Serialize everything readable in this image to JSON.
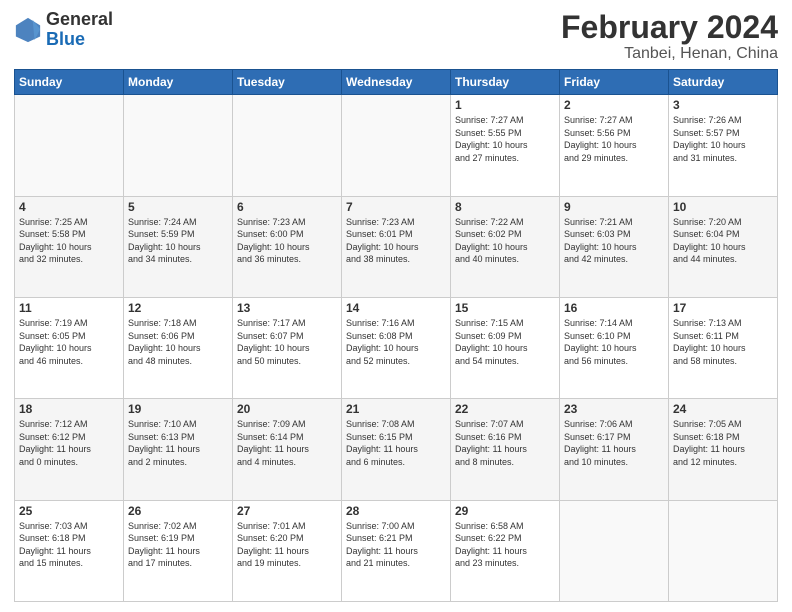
{
  "logo": {
    "general": "General",
    "blue": "Blue"
  },
  "header": {
    "title": "February 2024",
    "subtitle": "Tanbei, Henan, China"
  },
  "weekdays": [
    "Sunday",
    "Monday",
    "Tuesday",
    "Wednesday",
    "Thursday",
    "Friday",
    "Saturday"
  ],
  "weeks": [
    [
      {
        "day": "",
        "content": ""
      },
      {
        "day": "",
        "content": ""
      },
      {
        "day": "",
        "content": ""
      },
      {
        "day": "",
        "content": ""
      },
      {
        "day": "1",
        "content": "Sunrise: 7:27 AM\nSunset: 5:55 PM\nDaylight: 10 hours\nand 27 minutes."
      },
      {
        "day": "2",
        "content": "Sunrise: 7:27 AM\nSunset: 5:56 PM\nDaylight: 10 hours\nand 29 minutes."
      },
      {
        "day": "3",
        "content": "Sunrise: 7:26 AM\nSunset: 5:57 PM\nDaylight: 10 hours\nand 31 minutes."
      }
    ],
    [
      {
        "day": "4",
        "content": "Sunrise: 7:25 AM\nSunset: 5:58 PM\nDaylight: 10 hours\nand 32 minutes."
      },
      {
        "day": "5",
        "content": "Sunrise: 7:24 AM\nSunset: 5:59 PM\nDaylight: 10 hours\nand 34 minutes."
      },
      {
        "day": "6",
        "content": "Sunrise: 7:23 AM\nSunset: 6:00 PM\nDaylight: 10 hours\nand 36 minutes."
      },
      {
        "day": "7",
        "content": "Sunrise: 7:23 AM\nSunset: 6:01 PM\nDaylight: 10 hours\nand 38 minutes."
      },
      {
        "day": "8",
        "content": "Sunrise: 7:22 AM\nSunset: 6:02 PM\nDaylight: 10 hours\nand 40 minutes."
      },
      {
        "day": "9",
        "content": "Sunrise: 7:21 AM\nSunset: 6:03 PM\nDaylight: 10 hours\nand 42 minutes."
      },
      {
        "day": "10",
        "content": "Sunrise: 7:20 AM\nSunset: 6:04 PM\nDaylight: 10 hours\nand 44 minutes."
      }
    ],
    [
      {
        "day": "11",
        "content": "Sunrise: 7:19 AM\nSunset: 6:05 PM\nDaylight: 10 hours\nand 46 minutes."
      },
      {
        "day": "12",
        "content": "Sunrise: 7:18 AM\nSunset: 6:06 PM\nDaylight: 10 hours\nand 48 minutes."
      },
      {
        "day": "13",
        "content": "Sunrise: 7:17 AM\nSunset: 6:07 PM\nDaylight: 10 hours\nand 50 minutes."
      },
      {
        "day": "14",
        "content": "Sunrise: 7:16 AM\nSunset: 6:08 PM\nDaylight: 10 hours\nand 52 minutes."
      },
      {
        "day": "15",
        "content": "Sunrise: 7:15 AM\nSunset: 6:09 PM\nDaylight: 10 hours\nand 54 minutes."
      },
      {
        "day": "16",
        "content": "Sunrise: 7:14 AM\nSunset: 6:10 PM\nDaylight: 10 hours\nand 56 minutes."
      },
      {
        "day": "17",
        "content": "Sunrise: 7:13 AM\nSunset: 6:11 PM\nDaylight: 10 hours\nand 58 minutes."
      }
    ],
    [
      {
        "day": "18",
        "content": "Sunrise: 7:12 AM\nSunset: 6:12 PM\nDaylight: 11 hours\nand 0 minutes."
      },
      {
        "day": "19",
        "content": "Sunrise: 7:10 AM\nSunset: 6:13 PM\nDaylight: 11 hours\nand 2 minutes."
      },
      {
        "day": "20",
        "content": "Sunrise: 7:09 AM\nSunset: 6:14 PM\nDaylight: 11 hours\nand 4 minutes."
      },
      {
        "day": "21",
        "content": "Sunrise: 7:08 AM\nSunset: 6:15 PM\nDaylight: 11 hours\nand 6 minutes."
      },
      {
        "day": "22",
        "content": "Sunrise: 7:07 AM\nSunset: 6:16 PM\nDaylight: 11 hours\nand 8 minutes."
      },
      {
        "day": "23",
        "content": "Sunrise: 7:06 AM\nSunset: 6:17 PM\nDaylight: 11 hours\nand 10 minutes."
      },
      {
        "day": "24",
        "content": "Sunrise: 7:05 AM\nSunset: 6:18 PM\nDaylight: 11 hours\nand 12 minutes."
      }
    ],
    [
      {
        "day": "25",
        "content": "Sunrise: 7:03 AM\nSunset: 6:18 PM\nDaylight: 11 hours\nand 15 minutes."
      },
      {
        "day": "26",
        "content": "Sunrise: 7:02 AM\nSunset: 6:19 PM\nDaylight: 11 hours\nand 17 minutes."
      },
      {
        "day": "27",
        "content": "Sunrise: 7:01 AM\nSunset: 6:20 PM\nDaylight: 11 hours\nand 19 minutes."
      },
      {
        "day": "28",
        "content": "Sunrise: 7:00 AM\nSunset: 6:21 PM\nDaylight: 11 hours\nand 21 minutes."
      },
      {
        "day": "29",
        "content": "Sunrise: 6:58 AM\nSunset: 6:22 PM\nDaylight: 11 hours\nand 23 minutes."
      },
      {
        "day": "",
        "content": ""
      },
      {
        "day": "",
        "content": ""
      }
    ]
  ]
}
